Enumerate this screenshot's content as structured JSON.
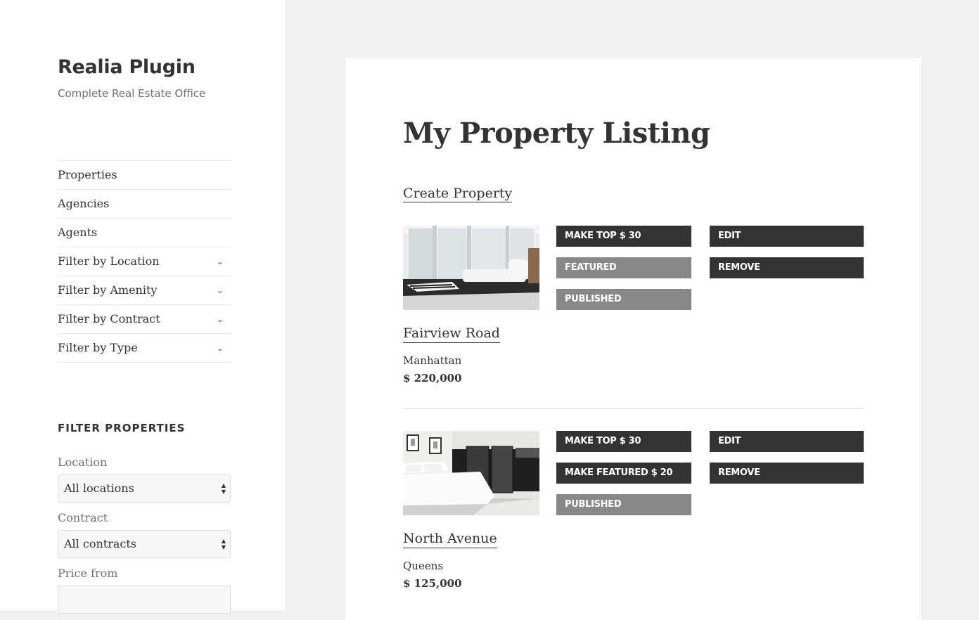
{
  "site": {
    "title": "Realia Plugin",
    "description": "Complete Real Estate Office"
  },
  "nav": {
    "items": [
      {
        "label": "Properties",
        "has_children": false
      },
      {
        "label": "Agencies",
        "has_children": false
      },
      {
        "label": "Agents",
        "has_children": false
      },
      {
        "label": "Filter by Location",
        "has_children": true
      },
      {
        "label": "Filter by Amenity",
        "has_children": true
      },
      {
        "label": "Filter by Contract",
        "has_children": true
      },
      {
        "label": "Filter by Type",
        "has_children": true
      }
    ],
    "chevron_icon": "chevron-down-icon"
  },
  "filter": {
    "title": "FILTER PROPERTIES",
    "location_label": "Location",
    "location_value": "All locations",
    "contract_label": "Contract",
    "contract_value": "All contracts",
    "price_from_label": "Price from",
    "price_from_value": ""
  },
  "main": {
    "title": "My Property Listing",
    "create_link": "Create Property",
    "listings": [
      {
        "name": "Fairview Road",
        "location": "Manhattan",
        "price": "$ 220,000",
        "image": "living-room-photo",
        "buttons": {
          "make_top": "MAKE TOP $ 30",
          "featured": "FEATURED",
          "published": "PUBLISHED",
          "edit": "EDIT",
          "remove": "REMOVE"
        }
      },
      {
        "name": "North Avenue",
        "location": "Queens",
        "price": "$ 125,000",
        "image": "bedroom-photo",
        "buttons": {
          "make_top": "MAKE TOP $ 30",
          "featured": "MAKE FEATURED $ 20",
          "published": "PUBLISHED",
          "edit": "EDIT",
          "remove": "REMOVE"
        }
      }
    ]
  },
  "colors": {
    "button_dark": "#333333",
    "button_grey": "#888888",
    "page_bg": "#f1f1f1"
  }
}
